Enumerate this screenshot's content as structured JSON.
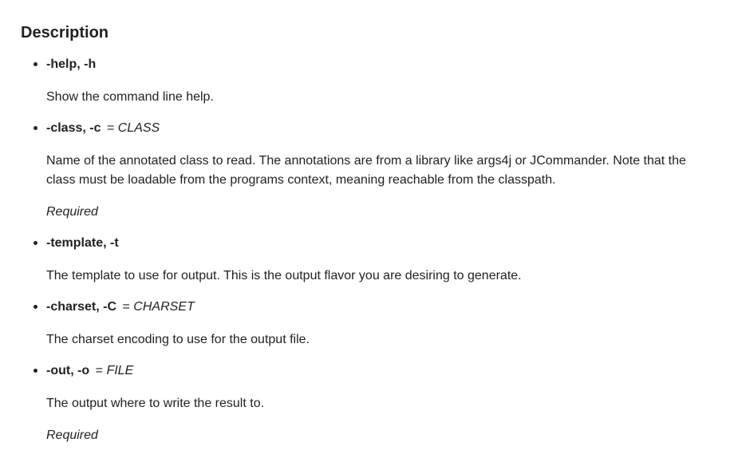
{
  "section": {
    "title": "Description"
  },
  "options": [
    {
      "name": "-help, -h",
      "eq": "",
      "arg": "",
      "description": "Show the command line help.",
      "required": ""
    },
    {
      "name": "-class, -c",
      "eq": "=",
      "arg": "CLASS",
      "description": "Name of the annotated class to read. The annotations are from a library like args4j or JCommander. Note that the class must be loadable from the programs context, meaning reachable from the classpath.",
      "required": "Required"
    },
    {
      "name": "-template, -t",
      "eq": "",
      "arg": "",
      "description": "The template to use for output. This is the output flavor you are desiring to generate.",
      "required": ""
    },
    {
      "name": "-charset, -C",
      "eq": "=",
      "arg": "CHARSET",
      "description": "The charset encoding to use for the output file.",
      "required": ""
    },
    {
      "name": "-out, -o",
      "eq": "=",
      "arg": "FILE",
      "description": "The output where to write the result to.",
      "required": "Required"
    }
  ]
}
